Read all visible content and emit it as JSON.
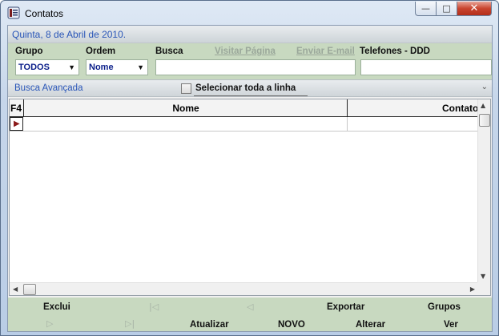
{
  "window": {
    "title": "Contatos",
    "controls": {
      "minimize": "—",
      "maximize": "□",
      "close": "✕"
    }
  },
  "date_bar": {
    "text": "Quinta, 8 de Abril de 2010."
  },
  "filters": {
    "grupo": {
      "label": "Grupo",
      "value": "TODOS"
    },
    "ordem": {
      "label": "Ordem",
      "value": "Nome"
    },
    "busca": {
      "label": "Busca",
      "value": ""
    },
    "visitar_pagina": {
      "label": "Visitar Página"
    },
    "enviar_email": {
      "label": "Enviar E-mail"
    },
    "telefones": {
      "label": "Telefones - DDD",
      "value": ""
    }
  },
  "advanced": {
    "label": "Busca Avançada",
    "select_row_label": "Selecionar toda a linha",
    "select_row_checked": false,
    "collapse_glyph": "⌄"
  },
  "grid": {
    "columns": [
      "F4",
      "Nome",
      "Contato"
    ],
    "rows": [
      {
        "indicator": "▶",
        "nome": "",
        "contato": ""
      }
    ]
  },
  "toolbar": {
    "exclui": "Exclui",
    "first": "|◁",
    "prev": "◁",
    "exportar": "Exportar",
    "grupos": "Grupos",
    "next": "▷",
    "last": "▷|",
    "atualizar": "Atualizar",
    "novo": "NOVO",
    "alterar": "Alterar",
    "ver": "Ver"
  },
  "colors": {
    "accent_blue": "#2a56b8",
    "panel_green": "#c8d9c0",
    "combo_text": "#0b1f8a",
    "disabled_text": "#9aa79a"
  }
}
